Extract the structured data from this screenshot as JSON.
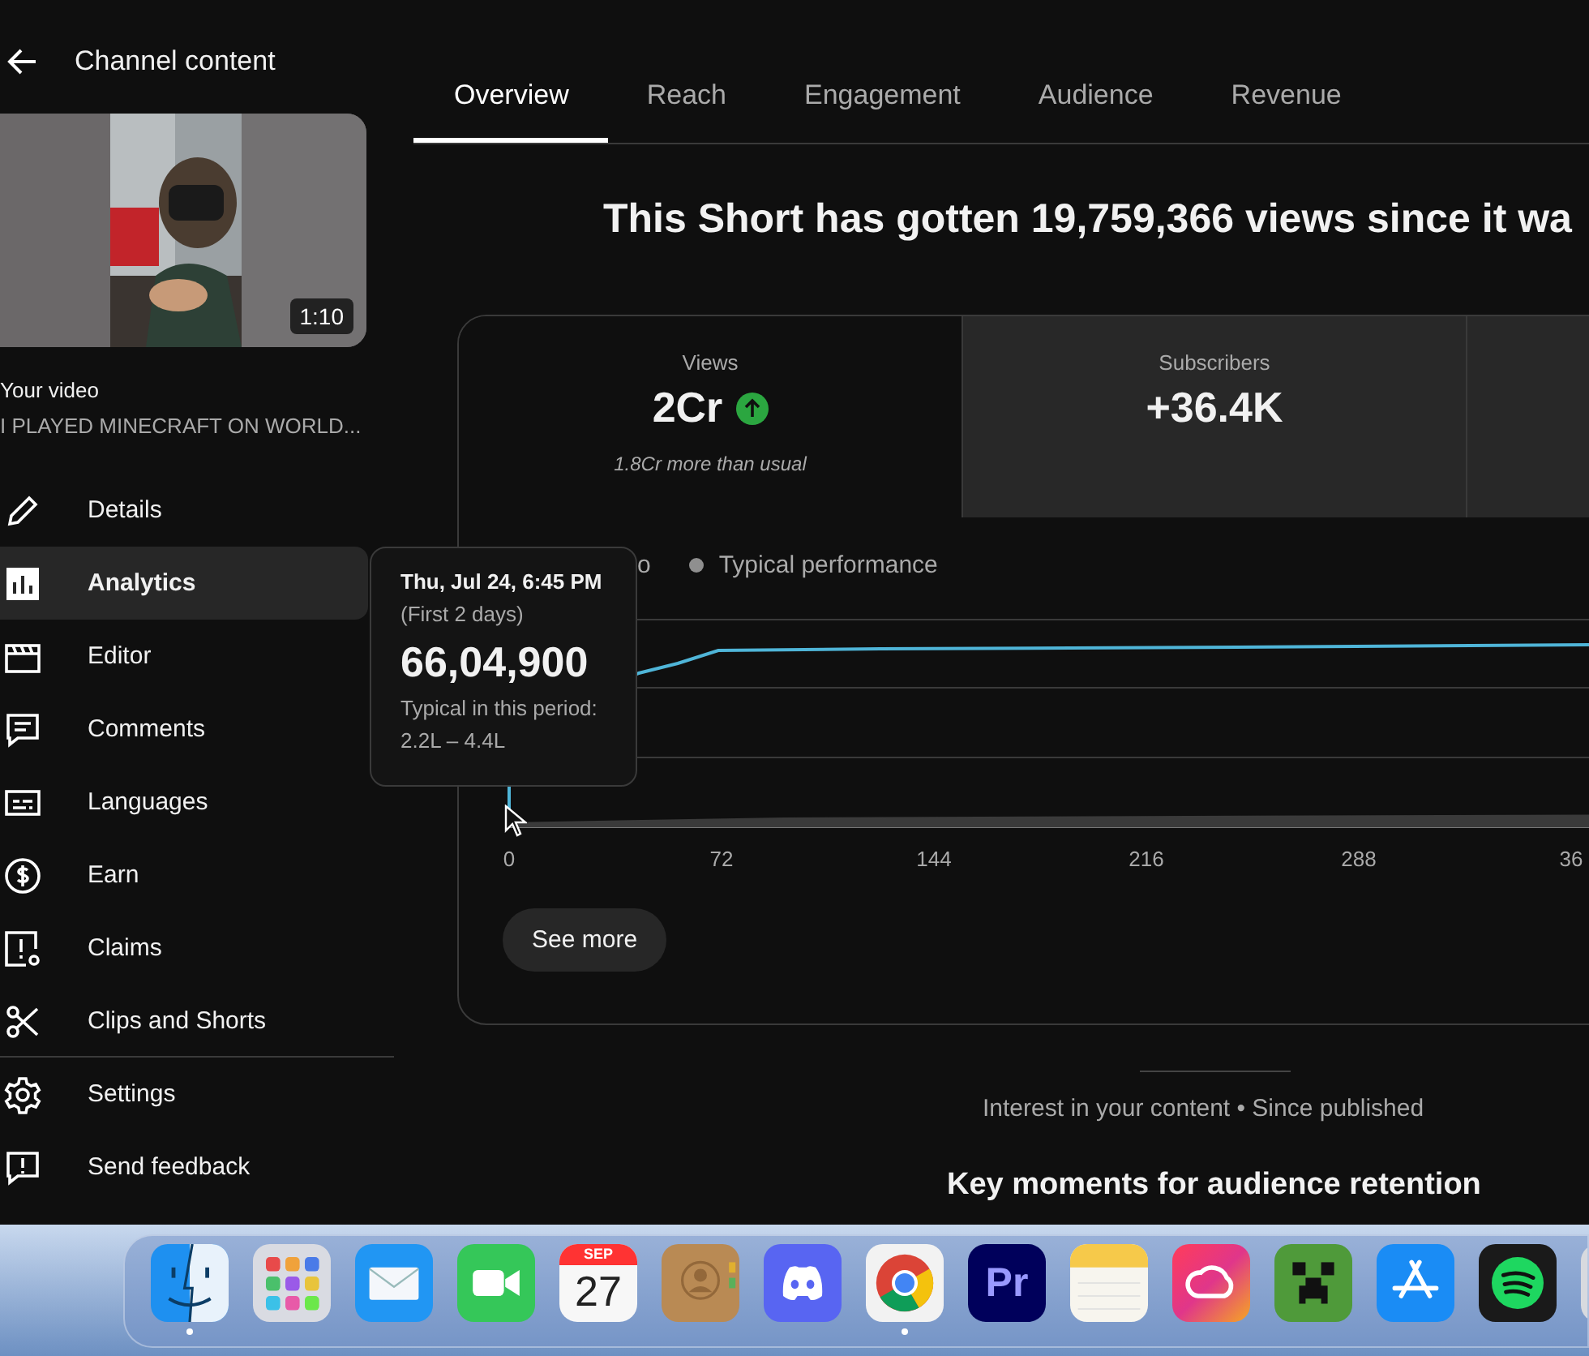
{
  "header": {
    "title": "Channel content"
  },
  "video": {
    "duration": "1:10",
    "label": "Your video",
    "title": "I PLAYED MINECRAFT ON WORLD..."
  },
  "nav": [
    {
      "label": "Details",
      "selected": false
    },
    {
      "label": "Analytics",
      "selected": true
    },
    {
      "label": "Editor",
      "selected": false
    },
    {
      "label": "Comments",
      "selected": false
    },
    {
      "label": "Languages",
      "selected": false
    },
    {
      "label": "Earn",
      "selected": false
    },
    {
      "label": "Claims",
      "selected": false
    },
    {
      "label": "Clips and Shorts",
      "selected": false
    }
  ],
  "nav_footer": [
    {
      "label": "Settings"
    },
    {
      "label": "Send feedback"
    }
  ],
  "tabs": [
    {
      "label": "Overview",
      "selected": true
    },
    {
      "label": "Reach",
      "selected": false
    },
    {
      "label": "Engagement",
      "selected": false
    },
    {
      "label": "Audience",
      "selected": false
    },
    {
      "label": "Revenue",
      "selected": false
    }
  ],
  "headline": "This Short has gotten 19,759,366 views since it wa",
  "metrics": [
    {
      "label": "Views",
      "value": "2Cr",
      "trending_up": true,
      "note": "1.8Cr more than usual",
      "selected": true
    },
    {
      "label": "Subscribers",
      "value": "+36.4K",
      "selected": false
    }
  ],
  "legend": [
    {
      "label": "o"
    },
    {
      "label": "Typical performance",
      "color": "#8f8f8f"
    }
  ],
  "x_ticks": [
    "0",
    "72",
    "144",
    "216",
    "288",
    "36"
  ],
  "see_more": "See more",
  "tooltip": {
    "date": "Thu, Jul 24, 6:45 PM",
    "period": "(First 2 days)",
    "value": "66,04,900",
    "typical_label": "Typical in this period:",
    "typical_range": "2.2L – 4.4L"
  },
  "interest": "Interest in your content • Since published",
  "key_moments": "Key moments for audience retention",
  "dock": [
    {
      "kind": "finder",
      "running": true
    },
    {
      "kind": "launchpad",
      "running": false
    },
    {
      "kind": "mail",
      "running": false
    },
    {
      "kind": "facetime",
      "running": false
    },
    {
      "kind": "calendar",
      "month": "SEP",
      "day": "27",
      "running": false
    },
    {
      "kind": "contacts",
      "running": false
    },
    {
      "kind": "discord",
      "running": false
    },
    {
      "kind": "chrome",
      "running": true
    },
    {
      "kind": "premiere",
      "text": "Pr",
      "running": false
    },
    {
      "kind": "notes",
      "running": false
    },
    {
      "kind": "creative-cloud",
      "running": false
    },
    {
      "kind": "minecraft",
      "running": false
    },
    {
      "kind": "app-store",
      "running": false
    },
    {
      "kind": "spotify",
      "running": false
    }
  ]
}
